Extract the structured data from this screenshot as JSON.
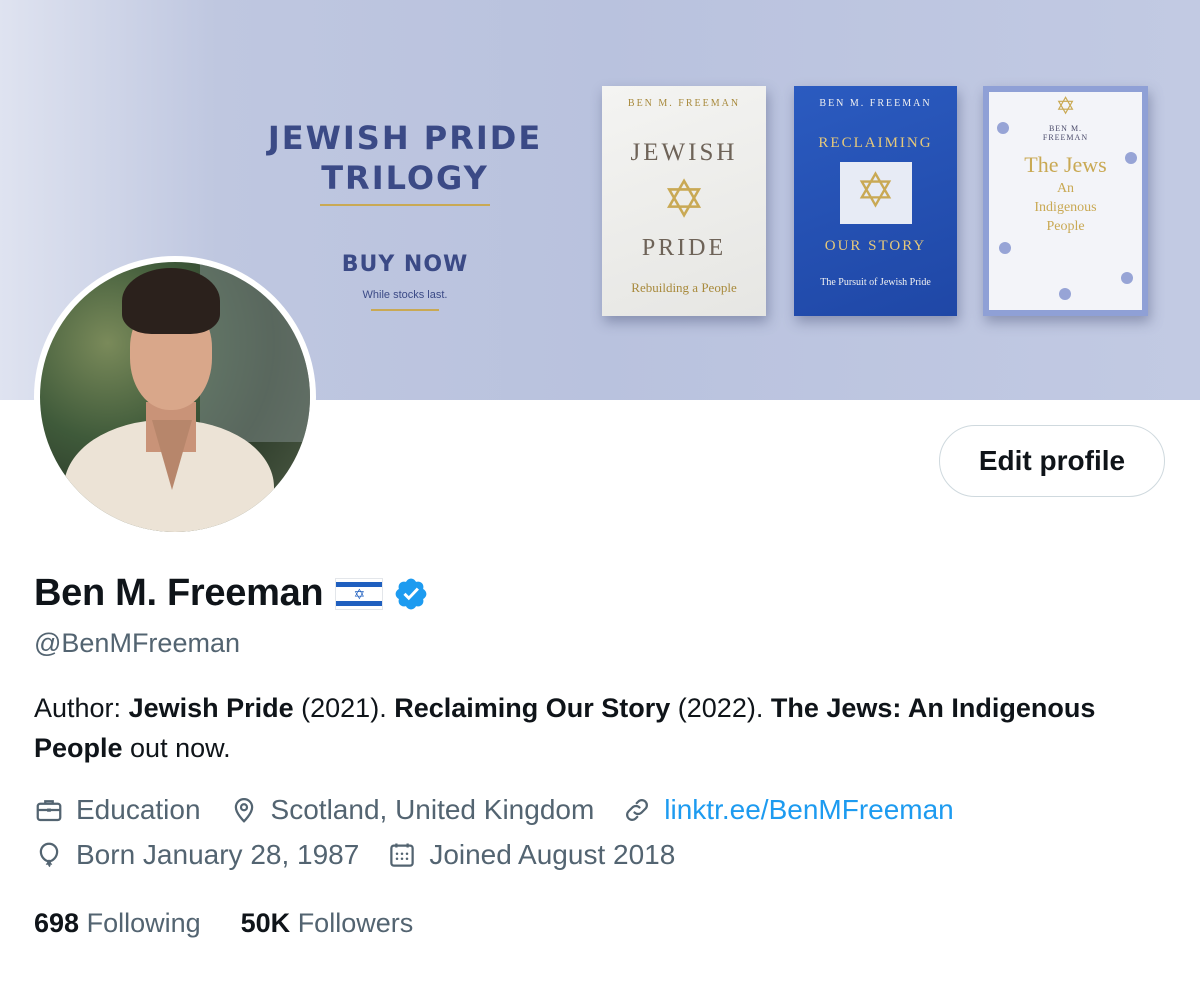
{
  "banner": {
    "promo_title_line1": "JEWISH PRIDE",
    "promo_title_line2": "TRILOGY",
    "promo_buy": "BUY NOW",
    "promo_sub": "While stocks last.",
    "books": [
      {
        "author": "BEN M. FREEMAN",
        "title_line1": "JEWISH",
        "title_line2": "PRIDE",
        "subtitle": "Rebuilding a People"
      },
      {
        "author": "BEN M. FREEMAN",
        "title_line1": "RECLAIMING",
        "title_line2": "OUR STORY",
        "subtitle": "The Pursuit of Jewish Pride"
      },
      {
        "author_line1": "BEN M.",
        "author_line2": "FREEMAN",
        "title_line1": "The Jews",
        "subtitle_line1": "An",
        "subtitle_line2": "Indigenous",
        "subtitle_line3": "People"
      }
    ]
  },
  "profile": {
    "name": "Ben M. Freeman",
    "handle": "@BenMFreeman",
    "edit_label": "Edit profile",
    "bio": {
      "prefix": "Author: ",
      "book1": "Jewish Pride",
      "year1": " (2021). ",
      "book2": "Reclaiming Our Story",
      "year2": " (2022). ",
      "book3": "The Jews: An Indigenous People",
      "suffix": " out now."
    },
    "meta": {
      "category": "Education",
      "location": "Scotland, United Kingdom",
      "link": "linktr.ee/BenMFreeman",
      "born": "Born January 28, 1987",
      "joined": "Joined August 2018"
    },
    "stats": {
      "following_count": "698",
      "following_label": "Following",
      "followers_count": "50K",
      "followers_label": "Followers"
    }
  },
  "colors": {
    "accent": "#1d9bf0",
    "verified": "#1d9bf0",
    "secondary_text": "#536471",
    "primary_text": "#0f1419",
    "banner_navy": "#3b4a86",
    "banner_gold": "#c9a954"
  },
  "icons": [
    "briefcase-icon",
    "location-pin-icon",
    "link-icon",
    "balloon-icon",
    "calendar-icon",
    "verified-badge-icon",
    "israel-flag-icon"
  ]
}
